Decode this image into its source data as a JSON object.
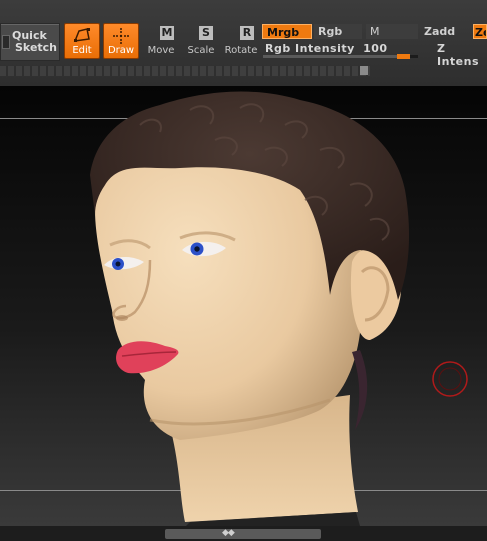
{
  "toolbar": {
    "quick_sketch": {
      "line1": "Quick",
      "line2": "Sketch"
    },
    "edit_label": "Edit",
    "draw_label": "Draw",
    "move": {
      "key": "M",
      "label": "Move"
    },
    "scale": {
      "key": "S",
      "label": "Scale"
    },
    "rotate": {
      "key": "R",
      "label": "Rotate"
    },
    "mrgb_label": "Mrgb",
    "rgb_label": "Rgb",
    "m_label": "M",
    "zadd_label": "Zadd",
    "zsub_label": "Ze",
    "rgb_intensity_label": "Rgb Intensity",
    "rgb_intensity_value": "100",
    "z_intensity_label": "Z Intens",
    "rgb_intensity_fraction": 1.0
  },
  "colors": {
    "accent": "#ef7a10",
    "skin": "#f1d4ad",
    "hair": "#3b2a24",
    "eyes": "#2c50c8",
    "lips": "#e0415a",
    "brush_ring": "#b01a1a"
  },
  "viewport": {
    "model": "sculpted human head",
    "bottom_control": "◆◆"
  }
}
